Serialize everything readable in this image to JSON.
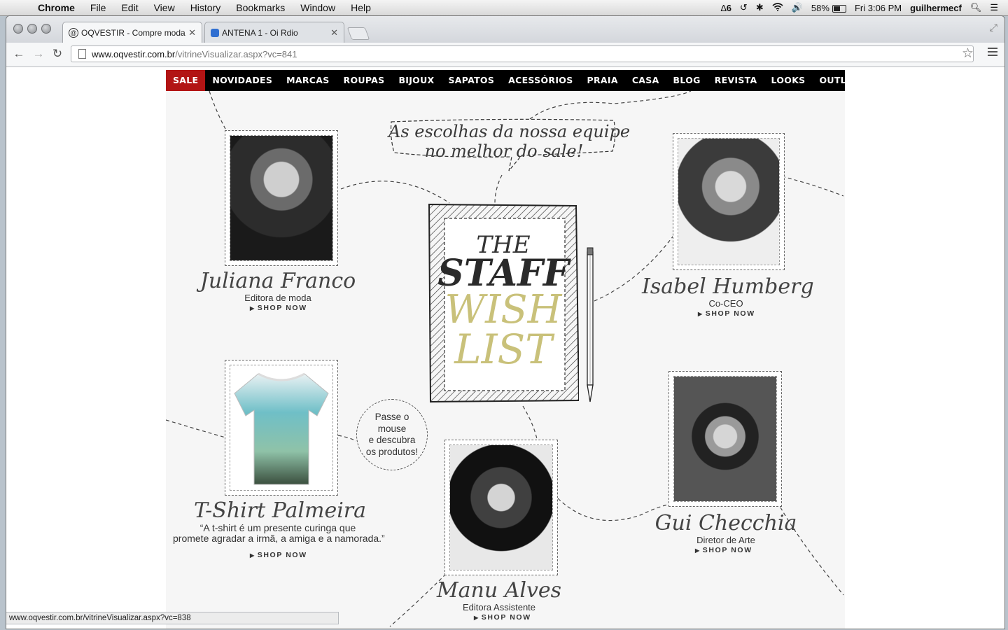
{
  "menubar": {
    "app": "Chrome",
    "menus": [
      "File",
      "Edit",
      "View",
      "History",
      "Bookmarks",
      "Window",
      "Help"
    ],
    "adobe_count": "6",
    "battery": "58%",
    "clock": "Fri 3:06 PM",
    "user": "guilhermecf"
  },
  "tabs": [
    {
      "title": "OQVESTIR - Compre moda c",
      "icon": "at-icon"
    },
    {
      "title": "ANTENA 1 - Oi Rdio",
      "icon": "rdio-icon"
    }
  ],
  "address": {
    "host": "www.oqvestir.com.br",
    "path": "/vitrineVisualizar.aspx?vc=841"
  },
  "nav": {
    "items": [
      "SALE",
      "NOVIDADES",
      "MARCAS",
      "ROUPAS",
      "BIJOUX",
      "SAPATOS",
      "ACESSÓRIOS",
      "PRAIA",
      "CASA",
      "BLOG",
      "REVISTA",
      "LOOKS",
      "OUTLET"
    ]
  },
  "speech": {
    "line1": "As escolhas da nossa equipe",
    "line2": "no melhor do sale!"
  },
  "notebook": {
    "line1": "THE",
    "line2": "STAFF",
    "line3": "WISH",
    "line4": "LIST",
    "gold": "#c9c17a"
  },
  "hint": {
    "line1": "Passe o",
    "line2": "mouse",
    "line3": "e descubra",
    "line4": "os produtos!"
  },
  "shop_label": "SHOP NOW",
  "staff": {
    "juliana": {
      "name": "Juliana Franco",
      "role": "Editora de moda"
    },
    "isabel": {
      "name": "Isabel Humberg",
      "role": "Co-CEO"
    },
    "gui": {
      "name": "Gui Checchia",
      "role": "Diretor de Arte"
    },
    "manu": {
      "name": "Manu Alves",
      "role": "Editora Assistente"
    }
  },
  "product": {
    "name": "T-Shirt Palmeira",
    "quote_line1": "“A t-shirt é um presente curinga que",
    "quote_line2": "promete agradar a irmã, a amiga e a namorada.”"
  },
  "status_url": "www.oqvestir.com.br/vitrineVisualizar.aspx?vc=838"
}
